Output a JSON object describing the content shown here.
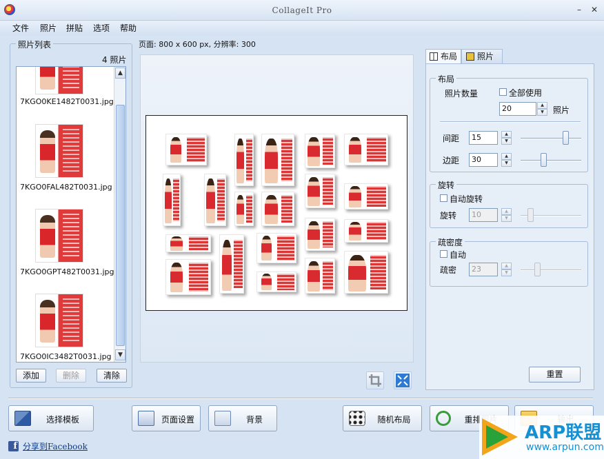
{
  "window": {
    "title": "CollageIt Pro",
    "minimize_glyph": "–",
    "close_glyph": "✕"
  },
  "menu": [
    "文件",
    "照片",
    "拼贴",
    "选项",
    "帮助"
  ],
  "photo_list": {
    "title": "照片列表",
    "count": "4 照片",
    "items": [
      {
        "filename": "7KGO0KE1482T0031.jpg"
      },
      {
        "filename": "7KGO0FAL482T0031.jpg"
      },
      {
        "filename": "7KGO0GPT482T0031.jpg"
      },
      {
        "filename": "7KGO0IC3482T0031.jpg"
      }
    ],
    "add_label": "添加",
    "delete_label": "删除",
    "clear_label": "清除"
  },
  "page_info": "页面: 800 x 600 px, 分辨率: 300",
  "right_panel": {
    "tabs": [
      {
        "label": "布局",
        "icon": "layout-icon",
        "active": true
      },
      {
        "label": "照片",
        "icon": "photo-icon",
        "active": false
      }
    ],
    "layout_group": {
      "title": "布局",
      "photo_count_label": "照片数量",
      "use_all_label": "全部使用",
      "photo_count_value": "20",
      "photo_unit": "照片",
      "spacing_label": "间距",
      "spacing_value": "15",
      "spacing_level": 0.74,
      "margin_label": "边距",
      "margin_value": "30",
      "margin_level": 0.37
    },
    "rotate_group": {
      "title": "旋转",
      "auto_rotate_label": "自动旋转",
      "rotate_label": "旋转",
      "rotate_value": "10",
      "rotate_level": 0.16
    },
    "density_group": {
      "title": "疏密度",
      "auto_label": "自动",
      "density_label": "疏密",
      "density_value": "23",
      "density_level": 0.27
    },
    "reset_label": "重置"
  },
  "bottom": {
    "template_label": "选择模板",
    "page_setup_label": "页面设置",
    "background_label": "背景",
    "random_layout_label": "随机布局",
    "reorder_label": "重排照片",
    "output_label": "输出",
    "facebook_label": "分享到Facebook"
  },
  "watermark": {
    "title": "ARP联盟",
    "url": "www.arpun.com"
  },
  "colors": {
    "accent": "#1591d3",
    "photo_red": "#d82a2f",
    "frame_bg": "#d6e3f3"
  }
}
